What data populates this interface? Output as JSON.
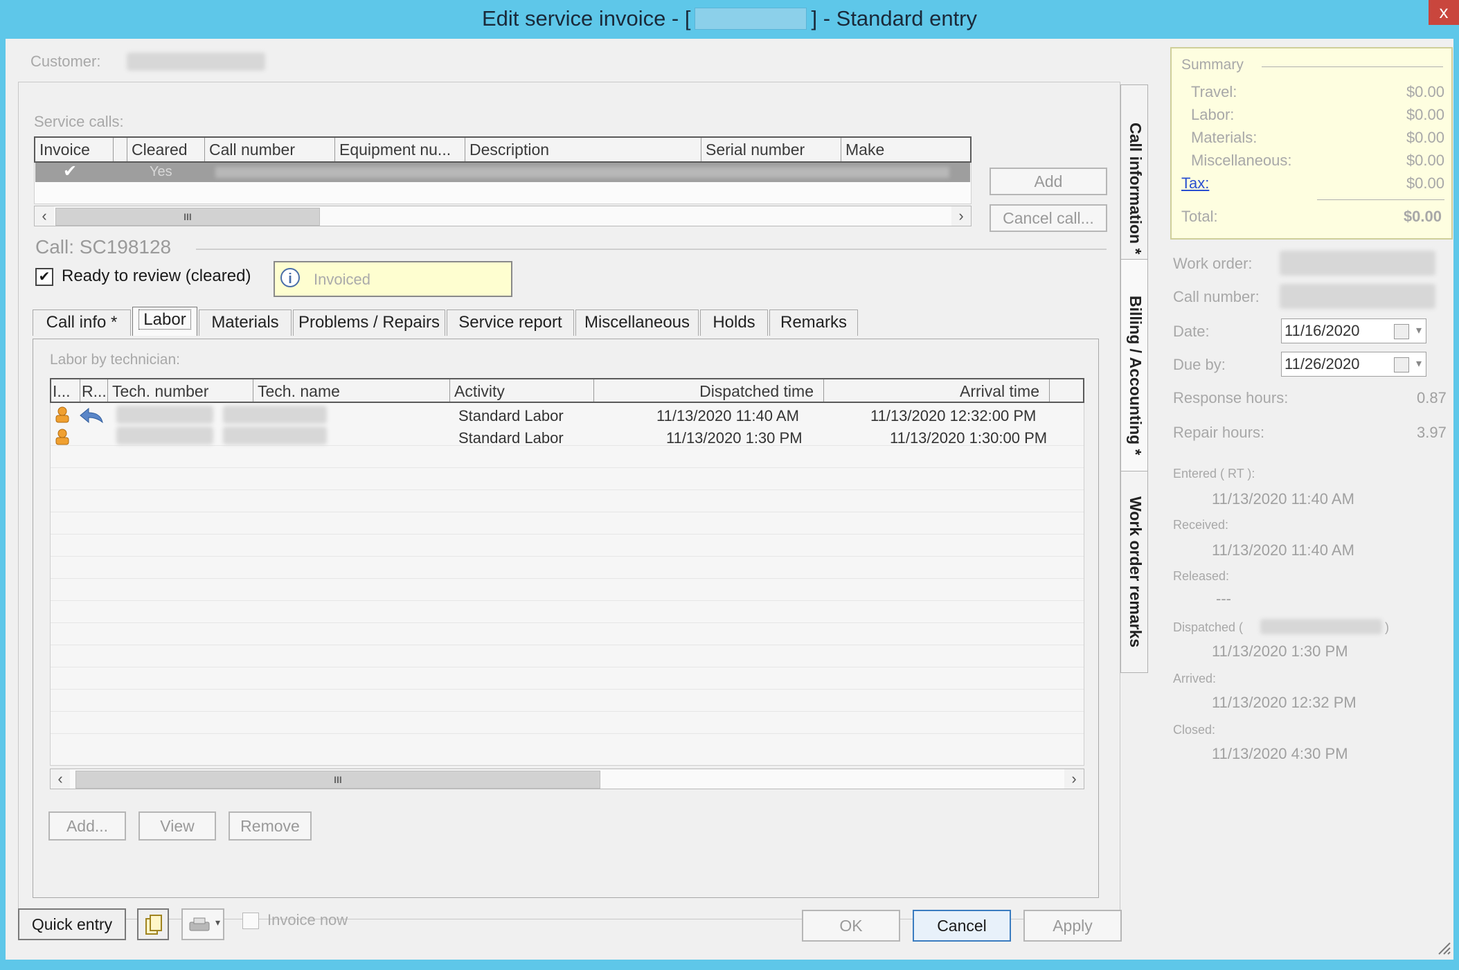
{
  "window": {
    "title_prefix": "Edit service invoice - [",
    "title_suffix": "] - Standard entry",
    "close_label": "x"
  },
  "customer": {
    "label": "Customer:"
  },
  "service_calls": {
    "label": "Service calls:",
    "columns": [
      "Invoice",
      "Cleared",
      "Call number",
      "Equipment nu...",
      "Description",
      "Serial number",
      "Make"
    ],
    "row": {
      "invoice_checked": "✔",
      "cleared": "Yes"
    },
    "add_label": "Add",
    "cancel_call_label": "Cancel call...",
    "scroll_thumb": "III"
  },
  "call": {
    "title": "Call: SC198128",
    "ready_to_review": "Ready to review (cleared)",
    "status": "Invoiced"
  },
  "tabs": [
    "Call info *",
    "Labor",
    "Materials",
    "Problems / Repairs",
    "Service report",
    "Miscellaneous",
    "Holds",
    "Remarks"
  ],
  "vertical_tabs": [
    "Call information *",
    "Billing / Accounting *",
    "Work order remarks"
  ],
  "labor": {
    "label": "Labor by technician:",
    "columns": [
      "I...",
      "R...",
      "Tech. number",
      "Tech. name",
      "Activity",
      "Dispatched time",
      "Arrival time"
    ],
    "rows": [
      {
        "activity": "Standard Labor",
        "dispatched": "11/13/2020 11:40 AM",
        "arrival": "11/13/2020 12:32:00 PM"
      },
      {
        "activity": "Standard Labor",
        "dispatched": "11/13/2020 1:30 PM",
        "arrival": "11/13/2020 1:30:00 PM"
      }
    ],
    "add_label": "Add...",
    "view_label": "View",
    "remove_label": "Remove",
    "scroll_thumb": "III"
  },
  "summary": {
    "title": "Summary",
    "rows": [
      {
        "label": "Travel:",
        "value": "$0.00"
      },
      {
        "label": "Labor:",
        "value": "$0.00"
      },
      {
        "label": "Materials:",
        "value": "$0.00"
      },
      {
        "label": "Miscellaneous:",
        "value": "$0.00"
      },
      {
        "label": "Tax:",
        "value": "$0.00"
      }
    ],
    "total_label": "Total:",
    "total_value": "$0.00"
  },
  "details": {
    "work_order_label": "Work order:",
    "call_number_label": "Call number:",
    "date_label": "Date:",
    "date_value": "11/16/2020",
    "due_by_label": "Due by:",
    "due_by_value": "11/26/2020",
    "response_hours_label": "Response hours:",
    "response_hours_value": "0.87",
    "repair_hours_label": "Repair hours:",
    "repair_hours_value": "3.97",
    "entered_label": "Entered ( RT ):",
    "entered_value": "11/13/2020 11:40 AM",
    "received_label": "Received:",
    "received_value": "11/13/2020 11:40 AM",
    "released_label": "Released:",
    "released_value": "---",
    "dispatched_label": "Dispatched (",
    "dispatched_close": ")",
    "dispatched_value": "11/13/2020 1:30 PM",
    "arrived_label": "Arrived:",
    "arrived_value": "11/13/2020 12:32 PM",
    "closed_label": "Closed:",
    "closed_value": "11/13/2020 4:30 PM"
  },
  "footer": {
    "quick_entry": "Quick entry",
    "invoice_now": "Invoice now",
    "ok": "OK",
    "cancel": "Cancel",
    "apply": "Apply"
  },
  "colors": {
    "title_bar": "#5ec7e9",
    "summary_bg": "#fefee0",
    "status_bg": "#fefed0"
  }
}
